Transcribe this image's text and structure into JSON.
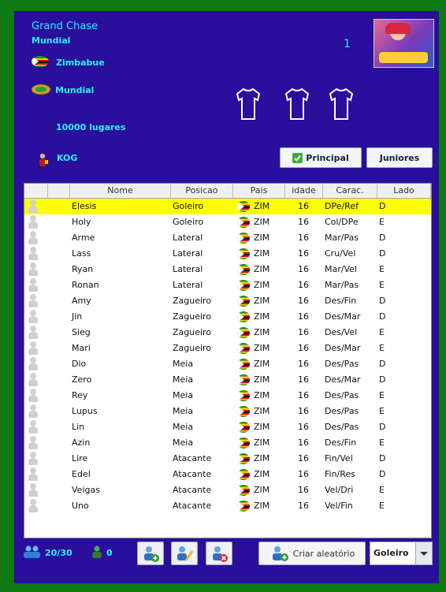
{
  "club": {
    "name": "Grand Chase",
    "league": "Mundial",
    "country": "Zimbabue",
    "stadium": "Mundial",
    "capacity": "10000 lugares",
    "owner": "KOG",
    "round_number": "1"
  },
  "tabs": {
    "principal": "Principal",
    "juniores": "Juniores"
  },
  "table": {
    "columns": [
      "Nome",
      "Posicao",
      "Pais",
      "idade",
      "Carac.",
      "Lado"
    ],
    "rows": [
      {
        "name": "Elesis",
        "position": "Goleiro",
        "country": "ZIM",
        "age": "16",
        "traits": "DPe/Ref",
        "side": "D",
        "selected": true
      },
      {
        "name": "Holy",
        "position": "Goleiro",
        "country": "ZIM",
        "age": "16",
        "traits": "Col/DPe",
        "side": "E"
      },
      {
        "name": "Arme",
        "position": "Lateral",
        "country": "ZIM",
        "age": "16",
        "traits": "Mar/Pas",
        "side": "D"
      },
      {
        "name": "Lass",
        "position": "Lateral",
        "country": "ZIM",
        "age": "16",
        "traits": "Cru/Vel",
        "side": "D"
      },
      {
        "name": "Ryan",
        "position": "Lateral",
        "country": "ZIM",
        "age": "16",
        "traits": "Mar/Vel",
        "side": "E"
      },
      {
        "name": "Ronan",
        "position": "Lateral",
        "country": "ZIM",
        "age": "16",
        "traits": "Mar/Pas",
        "side": "E"
      },
      {
        "name": "Amy",
        "position": "Zagueiro",
        "country": "ZIM",
        "age": "16",
        "traits": "Des/Fin",
        "side": "D"
      },
      {
        "name": "Jin",
        "position": "Zagueiro",
        "country": "ZIM",
        "age": "16",
        "traits": "Des/Mar",
        "side": "D"
      },
      {
        "name": "Sieg",
        "position": "Zagueiro",
        "country": "ZIM",
        "age": "16",
        "traits": "Des/Vel",
        "side": "E"
      },
      {
        "name": "Mari",
        "position": "Zagueiro",
        "country": "ZIM",
        "age": "16",
        "traits": "Des/Mar",
        "side": "E"
      },
      {
        "name": "Dio",
        "position": "Meia",
        "country": "ZIM",
        "age": "16",
        "traits": "Des/Pas",
        "side": "D"
      },
      {
        "name": "Zero",
        "position": "Meia",
        "country": "ZIM",
        "age": "16",
        "traits": "Des/Mar",
        "side": "D"
      },
      {
        "name": "Rey",
        "position": "Meia",
        "country": "ZIM",
        "age": "16",
        "traits": "Des/Pas",
        "side": "E"
      },
      {
        "name": "Lupus",
        "position": "Meia",
        "country": "ZIM",
        "age": "16",
        "traits": "Des/Pas",
        "side": "E"
      },
      {
        "name": "Lin",
        "position": "Meia",
        "country": "ZIM",
        "age": "16",
        "traits": "Des/Pas",
        "side": "D"
      },
      {
        "name": "Azin",
        "position": "Meia",
        "country": "ZIM",
        "age": "16",
        "traits": "Des/Fin",
        "side": "E"
      },
      {
        "name": "Lire",
        "position": "Atacante",
        "country": "ZIM",
        "age": "16",
        "traits": "Fin/Vel",
        "side": "D"
      },
      {
        "name": "Edel",
        "position": "Atacante",
        "country": "ZIM",
        "age": "16",
        "traits": "Fin/Res",
        "side": "D"
      },
      {
        "name": "Veigas",
        "position": "Atacante",
        "country": "ZIM",
        "age": "16",
        "traits": "Vel/Dri",
        "side": "E"
      },
      {
        "name": "Uno",
        "position": "Atacante",
        "country": "ZIM",
        "age": "16",
        "traits": "Vel/Fin",
        "side": "E"
      }
    ]
  },
  "footer": {
    "squad_count": "20/30",
    "junior_count": "0",
    "random_button": "Criar aleatório",
    "position_select": "Goleiro"
  },
  "colors": {
    "frame": "#0d7a12",
    "panel": "#2a0e9c",
    "accent_text": "#26f2ff",
    "selected_row": "#ffff00"
  },
  "icons": {
    "country_flag": "zimbabwe-flag-icon",
    "stadium": "stadium-icon",
    "owner": "owner-icon",
    "jersey": "jersey-icon",
    "principal": "check-icon",
    "squad": "users-icon",
    "junior": "user-icon",
    "add_player": "add-player-icon",
    "edit_player": "edit-player-icon",
    "remove_player": "remove-player-icon",
    "random": "add-user-icon",
    "dropdown": "chevron-down-icon"
  }
}
